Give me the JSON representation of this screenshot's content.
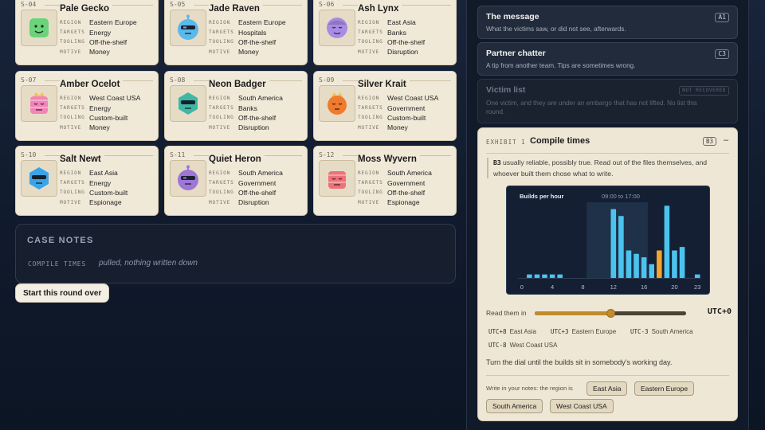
{
  "suspects": [
    {
      "code": "S-04",
      "name": "Pale Gecko",
      "region": "Eastern Europe",
      "targets": "Energy",
      "tooling": "Off-the-shelf",
      "motive": "Money",
      "avatar": "green-square-face-icon",
      "color": "#6bd37a"
    },
    {
      "code": "S-05",
      "name": "Jade Raven",
      "region": "Eastern Europe",
      "targets": "Hospitals",
      "tooling": "Off-the-shelf",
      "motive": "Money",
      "avatar": "blue-robot-face-icon",
      "color": "#5bb8ea"
    },
    {
      "code": "S-06",
      "name": "Ash Lynx",
      "region": "East Asia",
      "targets": "Banks",
      "tooling": "Off-the-shelf",
      "motive": "Disruption",
      "avatar": "purple-round-face-icon",
      "color": "#a88be4"
    },
    {
      "code": "S-07",
      "name": "Amber Ocelot",
      "region": "West Coast USA",
      "targets": "Energy",
      "tooling": "Custom-built",
      "motive": "Money",
      "avatar": "pink-striped-crown-icon",
      "color": "#f284b8"
    },
    {
      "code": "S-08",
      "name": "Neon Badger",
      "region": "South America",
      "targets": "Banks",
      "tooling": "Off-the-shelf",
      "motive": "Disruption",
      "avatar": "teal-hexagon-visor-icon",
      "color": "#3fb7a4"
    },
    {
      "code": "S-09",
      "name": "Silver Krait",
      "region": "West Coast USA",
      "targets": "Government",
      "tooling": "Custom-built",
      "motive": "Money",
      "avatar": "orange-crown-face-icon",
      "color": "#f07b2e"
    },
    {
      "code": "S-10",
      "name": "Salt Newt",
      "region": "East Asia",
      "targets": "Energy",
      "tooling": "Custom-built",
      "motive": "Espionage",
      "avatar": "blue-hexagon-visor-icon",
      "color": "#3aa4e8"
    },
    {
      "code": "S-11",
      "name": "Quiet Heron",
      "region": "South America",
      "targets": "Government",
      "tooling": "Off-the-shelf",
      "motive": "Disruption",
      "avatar": "purple-robot-visor-icon",
      "color": "#9d76d6"
    },
    {
      "code": "S-12",
      "name": "Moss Wyvern",
      "region": "South America",
      "targets": "Government",
      "tooling": "Off-the-shelf",
      "motive": "Espionage",
      "avatar": "red-striped-face-icon",
      "color": "#ee7178"
    }
  ],
  "labels": {
    "region": "REGION",
    "targets": "TARGETS",
    "tooling": "TOOLING",
    "motive": "MOTIVE"
  },
  "case_notes": {
    "title": "CASE NOTES",
    "key": "COMPILE TIMES",
    "value": "pulled, nothing written down"
  },
  "restart_label": "Start this round over",
  "sources": [
    {
      "title": "The message",
      "desc": "What the victims saw, or did not see, afterwards.",
      "tag": "A1"
    },
    {
      "title": "Partner chatter",
      "desc": "A tip from another team. Tips are sometimes wrong.",
      "tag": "C3"
    },
    {
      "title": "Victim list",
      "desc": "One victim, and they are under an embargo that has not lifted. No list this round.",
      "tag": "NOT RECOVERED"
    }
  ],
  "exhibit": {
    "label": "EXHIBIT 1",
    "title": "Compile times",
    "tag": "B3",
    "collapse": "–",
    "quote_code": "B3",
    "quote_text": " usually reliable, possibly true. Read out of the files themselves, and whoever built them chose what to write.",
    "read_label": "Read them in",
    "utc_value": "UTC+0",
    "slider_fraction": 0.5,
    "timezones": [
      {
        "offset": "UTC+8",
        "region": "East Asia"
      },
      {
        "offset": "UTC+3",
        "region": "Eastern Europe"
      },
      {
        "offset": "UTC-3",
        "region": "South America"
      },
      {
        "offset": "UTC-8",
        "region": "West Coast USA"
      }
    ],
    "hint": "Turn the dial until the builds sit in somebody's working day.",
    "notes_label": "Write in your notes: the region is",
    "choices": [
      "East Asia",
      "Eastern Europe",
      "South America",
      "West Coast USA"
    ]
  },
  "chart_data": {
    "type": "bar",
    "title": "Builds per hour",
    "window_label": "09:00 to 17:00",
    "window": [
      9,
      17
    ],
    "x": [
      0,
      1,
      2,
      3,
      4,
      5,
      6,
      7,
      8,
      9,
      10,
      11,
      12,
      13,
      14,
      15,
      16,
      17,
      18,
      19,
      20,
      21,
      22,
      23
    ],
    "values": [
      0,
      1,
      1,
      1,
      1,
      1,
      0,
      0,
      0,
      0,
      0,
      0,
      20,
      18,
      8,
      7,
      6,
      4,
      8,
      21,
      8,
      9,
      0,
      1
    ],
    "highlight_index": 18,
    "xticks": [
      0,
      4,
      8,
      12,
      16,
      20,
      23
    ],
    "ylim": [
      0,
      22
    ],
    "bar_color": "#4cc3ee",
    "highlight_color": "#f0a431",
    "window_color": "#1f3049"
  }
}
